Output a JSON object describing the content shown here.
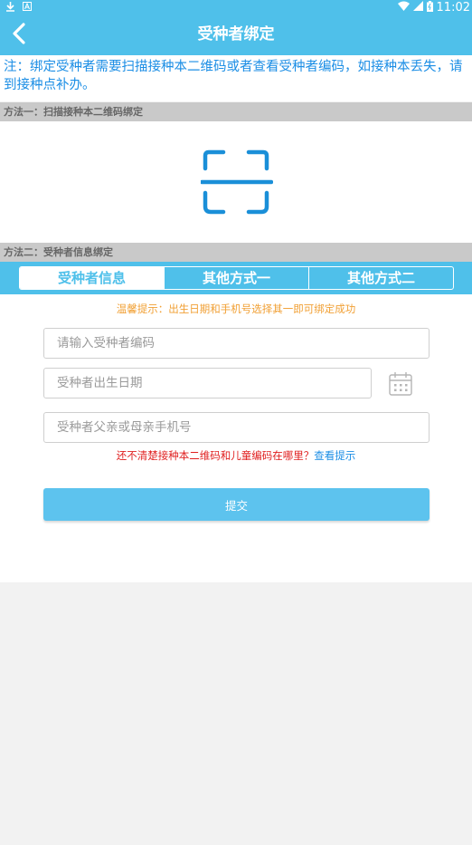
{
  "status_bar": {
    "time": "11:02",
    "icons": [
      "download-icon",
      "a-icon",
      "wifi-icon",
      "signal-icon",
      "battery-icon"
    ]
  },
  "app_bar": {
    "back_icon": "chevron-left-icon",
    "title": "受种者绑定"
  },
  "notice": "注：绑定受种者需要扫描接种本二维码或者查看受种者编码，如接种本丢失，请到接种点补办。",
  "method_one": {
    "header": "方法一：扫描接种本二维码绑定",
    "scan_icon": "qr-scan-icon"
  },
  "method_two": {
    "header": "方法二：受种者信息绑定",
    "tabs": [
      {
        "label": "受种者信息",
        "active": true
      },
      {
        "label": "其他方式一",
        "active": false
      },
      {
        "label": "其他方式二",
        "active": false
      }
    ]
  },
  "form": {
    "tip": "温馨提示：出生日期和手机号选择其一即可绑定成功",
    "code_placeholder": "请输入受种者编码",
    "birthdate_placeholder": "受种者出生日期",
    "calendar_icon": "calendar-icon",
    "phone_placeholder": "受种者父亲或母亲手机号",
    "help_text": "还不清楚接种本二维码和儿童编码在哪里？",
    "help_link": "查看提示",
    "submit_label": "提交"
  },
  "colors": {
    "primary": "#4fc0ea",
    "link": "#1c8ee5",
    "tip": "#f1a035",
    "warning": "#e02020",
    "section_header": "#c9c9c9"
  }
}
